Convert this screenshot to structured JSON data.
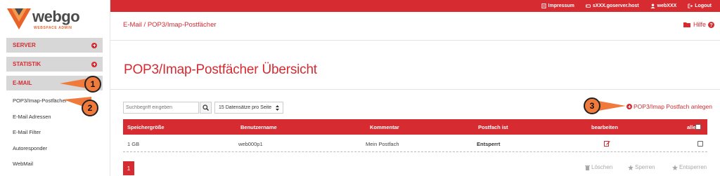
{
  "topbar": {
    "links": [
      {
        "label": "Impressum",
        "icon": "document-icon"
      },
      {
        "label": "sXXX.goserver.host",
        "icon": "server-icon"
      },
      {
        "label": "webXXX",
        "icon": "user-icon"
      },
      {
        "label": "Logout",
        "icon": "logout-icon"
      }
    ]
  },
  "logo": {
    "brand": "webgo",
    "sub": "WEBSPACE ADMIN"
  },
  "sidebar": {
    "sections": [
      {
        "label": "SERVER"
      },
      {
        "label": "STATISTIK"
      },
      {
        "label": "E-MAIL"
      }
    ],
    "items": [
      {
        "label": "POP3/Imap-Postfächer"
      },
      {
        "label": "E-Mail Adressen"
      },
      {
        "label": "E-Mail Filter"
      },
      {
        "label": "Autoresponder"
      },
      {
        "label": "WebMail"
      }
    ]
  },
  "callouts": [
    "1",
    "2",
    "3"
  ],
  "main": {
    "breadcrumb": "E-Mail / POP3/Imap-Postfächer",
    "help": "Hilfe",
    "title": "POP3/Imap-Postfächer Übersicht",
    "search_placeholder": "Suchbegriff eingeben",
    "per_page": "15 Datensätze pro Seite",
    "create_label": "POP3/Imap Postfach anlegen"
  },
  "table": {
    "headers": [
      "Speichergröße",
      "Benutzername",
      "Kommentar",
      "Postfach ist",
      "bearbeiten",
      "alle"
    ],
    "rows": [
      {
        "size": "1 GB",
        "user": "web000p1",
        "comment": "Mein Postfach",
        "state": "Entsperrt"
      }
    ]
  },
  "pagination": {
    "current": "1"
  },
  "actions": [
    {
      "label": "Löschen",
      "icon": "trash-icon"
    },
    {
      "label": "Sperren",
      "icon": "star-icon"
    },
    {
      "label": "Entsperren",
      "icon": "star-icon"
    }
  ],
  "colors": {
    "brand_red": "#d52b31",
    "callout_orange": "#f07a3c",
    "logo_orange": "#e8622a"
  }
}
